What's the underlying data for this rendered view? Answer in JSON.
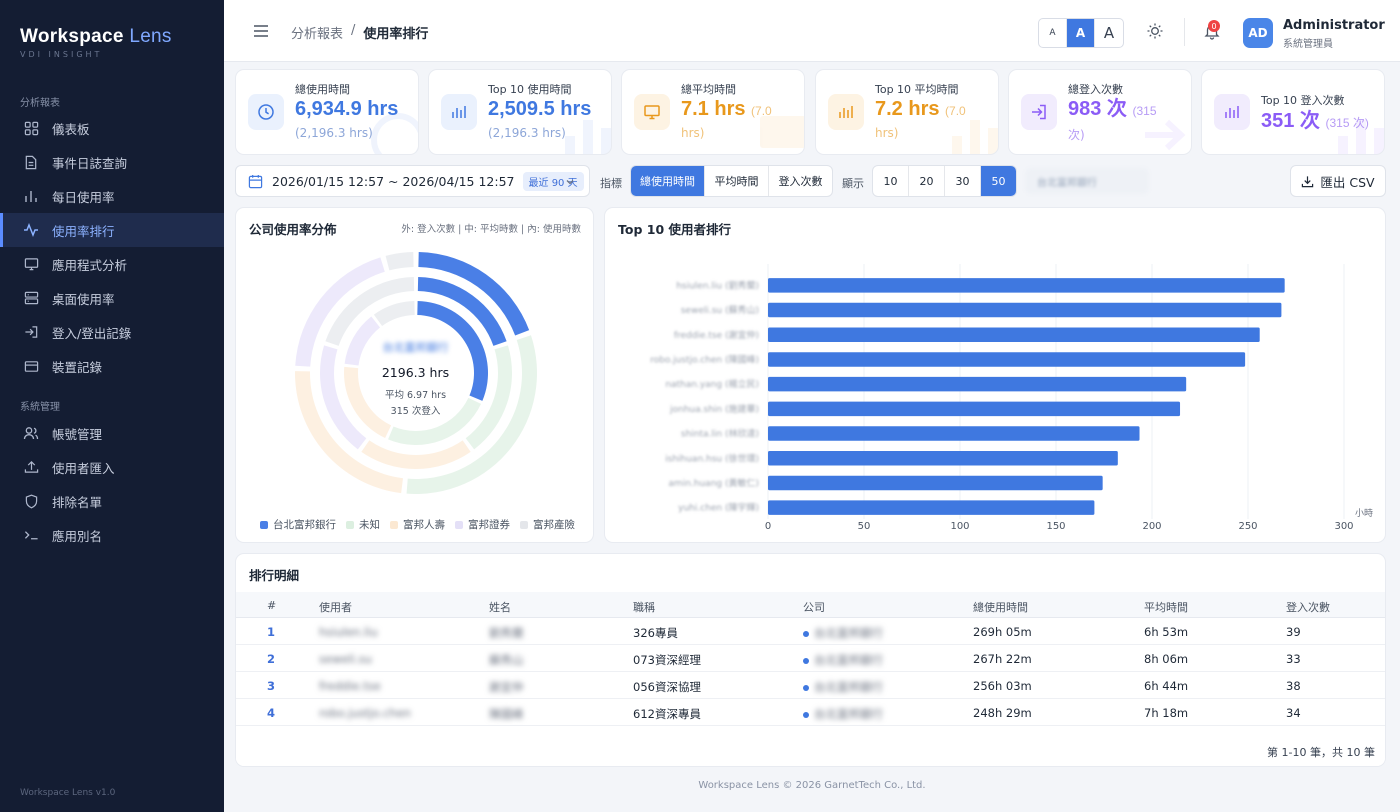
{
  "brand": {
    "name_main": "Workspace",
    "name_accent": "Lens",
    "tagline": "VDI INSIGHT",
    "version": "Workspace Lens v1.0"
  },
  "sidebar": {
    "section_reports": "分析報表",
    "section_admin": "系統管理",
    "items": [
      {
        "label": "儀表板",
        "icon": "grid-icon"
      },
      {
        "label": "事件日誌查詢",
        "icon": "document-icon"
      },
      {
        "label": "每日使用率",
        "icon": "bar-chart-icon"
      },
      {
        "label": "使用率排行",
        "icon": "pulse-icon",
        "active": true
      },
      {
        "label": "應用程式分析",
        "icon": "monitor-icon"
      },
      {
        "label": "桌面使用率",
        "icon": "server-icon"
      },
      {
        "label": "登入/登出記錄",
        "icon": "login-icon"
      },
      {
        "label": "裝置記錄",
        "icon": "card-icon"
      },
      {
        "label": "帳號管理",
        "icon": "users-icon"
      },
      {
        "label": "使用者匯入",
        "icon": "upload-icon"
      },
      {
        "label": "排除名單",
        "icon": "shield-icon"
      },
      {
        "label": "應用別名",
        "icon": "terminal-icon"
      }
    ]
  },
  "topbar": {
    "breadcrumb_parent": "分析報表",
    "breadcrumb_sep": "/",
    "breadcrumb_current": "使用率排行",
    "font_sizes": [
      "A",
      "A",
      "A"
    ],
    "notification_count": "0",
    "avatar_initials": "AD",
    "user_name": "Administrator",
    "user_role": "系統管理員"
  },
  "kpis": [
    {
      "label": "總使用時間",
      "value": "6,934.9 hrs",
      "sub": "(2,196.3 hrs)",
      "color": "#3f78e0",
      "icon": "clock-icon"
    },
    {
      "label": "Top 10 使用時間",
      "value": "2,509.5 hrs",
      "sub": "(2,196.3 hrs)",
      "color": "#3f78e0",
      "icon": "bar-chart-icon"
    },
    {
      "label": "總平均時間",
      "value": "7.1 hrs",
      "inline": "(7.0",
      "sub": "hrs)",
      "color": "#e8981c",
      "icon": "monitor-icon"
    },
    {
      "label": "Top 10 平均時間",
      "value": "7.2 hrs",
      "inline": "(7.0",
      "sub": "hrs)",
      "color": "#e8981c",
      "icon": "bar-chart-icon"
    },
    {
      "label": "總登入次數",
      "value": "983 次",
      "inline": "(315",
      "sub": "次)",
      "color": "#8b5cf6",
      "icon": "login-icon"
    },
    {
      "label": "Top 10 登入次數",
      "value": "351 次",
      "inline": "(315 次)",
      "sub": "",
      "color": "#8b5cf6",
      "icon": "bar-chart-icon"
    }
  ],
  "filters": {
    "date_range": "2026/01/15 12:57 ~ 2026/04/15 12:57",
    "date_preset": "最近 90 天",
    "metric_label": "指標",
    "metrics": [
      "總使用時間",
      "平均時間",
      "登入次數"
    ],
    "show_label": "顯示",
    "show_counts": [
      "10",
      "20",
      "30",
      "50"
    ],
    "company_filter": "台北富邦銀行",
    "export_label": "匯出 CSV"
  },
  "donut": {
    "title": "公司使用率分佈",
    "hint": "外: 登入次數 | 中: 平均時數 | 內: 使用時數",
    "center_company": "台北富邦銀行",
    "center_value": "2196.3 hrs",
    "center_avg": "平均 6.97 hrs",
    "center_logins": "315 次登入",
    "legend": [
      {
        "name": "台北富邦銀行",
        "color": "#4a7fe6"
      },
      {
        "name": "未知",
        "color": "#dcefe0"
      },
      {
        "name": "富邦人壽",
        "color": "#fbe8d2"
      },
      {
        "name": "富邦證券",
        "color": "#e4e0f7"
      },
      {
        "name": "富邦產險",
        "color": "#e4e6ea"
      }
    ],
    "rings": {
      "outer": [
        0.196,
        0.32,
        0.24,
        0.2,
        0.044
      ],
      "middle": [
        0.2,
        0.2,
        0.2,
        0.2,
        0.2
      ],
      "inner": [
        0.317,
        0.25,
        0.2,
        0.13,
        0.103
      ]
    }
  },
  "chart_data": {
    "type": "bar",
    "title": "Top 10 使用者排行",
    "orientation": "horizontal",
    "xlabel": "小時",
    "xlim": [
      0,
      300
    ],
    "xticks": [
      "0",
      "50",
      "100",
      "150",
      "200",
      "250",
      "300"
    ],
    "categories": [
      "hsiulen.liu (劉秀蘭)",
      "seweli.su (蘇秀山)",
      "freddie.tse (謝宜仲)",
      "robo.justjo.chen (陳國峰)",
      "nathan.yang (楊立民)",
      "jonhua.shin (施建華)",
      "shinta.lin (林欣達)",
      "ishihuan.hsu (徐世環)",
      "amin.huang (黃敏仁)",
      "yuhi.chen (陳宇輝)"
    ],
    "values": [
      269.1,
      267.4,
      256.1,
      248.5,
      217.8,
      214.6,
      193.5,
      182.2,
      174.3,
      170.0
    ],
    "bar_color": "#3f78e0"
  },
  "table": {
    "title": "排行明細",
    "columns": [
      "#",
      "使用者",
      "姓名",
      "職稱",
      "公司",
      "總使用時間",
      "平均時間",
      "登入次數"
    ],
    "rows": [
      {
        "rank": "1",
        "user": "hsiulen.liu",
        "name": "劉秀蘭",
        "title": "326專員",
        "company": "台北富邦銀行",
        "total": "269h 05m",
        "avg": "6h 53m",
        "logins": "39"
      },
      {
        "rank": "2",
        "user": "seweli.su",
        "name": "蘇秀山",
        "title": "073資深經理",
        "company": "台北富邦銀行",
        "total": "267h 22m",
        "avg": "8h 06m",
        "logins": "33"
      },
      {
        "rank": "3",
        "user": "freddie.tse",
        "name": "謝宜仲",
        "title": "056資深協理",
        "company": "台北富邦銀行",
        "total": "256h 03m",
        "avg": "6h 44m",
        "logins": "38"
      },
      {
        "rank": "4",
        "user": "robo.justjo.chen",
        "name": "陳國峰",
        "title": "612資深專員",
        "company": "台北富邦銀行",
        "total": "248h 29m",
        "avg": "7h 18m",
        "logins": "34"
      }
    ],
    "pager": "第 1-10 筆，共 10 筆"
  },
  "footer": "Workspace Lens © 2026 GarnetTech Co., Ltd."
}
